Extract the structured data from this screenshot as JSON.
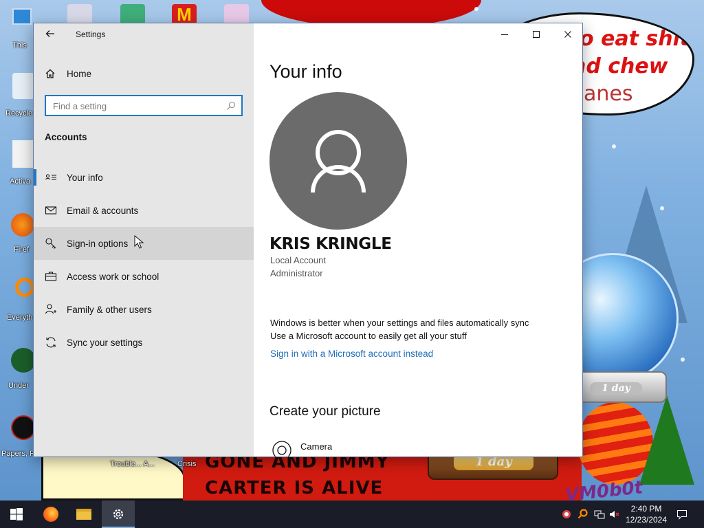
{
  "window": {
    "title": "Settings",
    "minimize_icon": "minimize-icon",
    "maximize_icon": "maximize-icon",
    "close_icon": "close-icon"
  },
  "sidebar": {
    "home_label": "Home",
    "search_placeholder": "Find a setting",
    "section_title": "Accounts",
    "items": [
      {
        "label": "Your info",
        "icon": "your-info-icon",
        "active": true
      },
      {
        "label": "Email & accounts",
        "icon": "mail-icon"
      },
      {
        "label": "Sign-in options",
        "icon": "key-icon",
        "hover": true
      },
      {
        "label": "Access work or school",
        "icon": "briefcase-icon"
      },
      {
        "label": "Family & other users",
        "icon": "person-add-icon"
      },
      {
        "label": "Sync your settings",
        "icon": "sync-icon"
      }
    ]
  },
  "main": {
    "page_title": "Your info",
    "user_name": "KRIS KRINGLE",
    "account_type": "Local Account",
    "role": "Administrator",
    "sync_line1": "Windows is better when your settings and files automatically sync",
    "sync_line2": "Use a Microsoft account to easily get all your stuff",
    "ms_link": "Sign in with a Microsoft account instead",
    "create_picture_heading": "Create your picture",
    "camera_label": "Camera"
  },
  "desktop": {
    "speech_text": [
      "o eat shit",
      "nd chew",
      "anes"
    ],
    "banner_text": [
      "GONE AND JIMMY",
      "CARTER IS ALIVE"
    ],
    "globe_labels": [
      "1 day",
      "1 day"
    ],
    "icons": [
      {
        "label": "This",
        "icon": "computer-icon"
      },
      {
        "label": "Recycle",
        "icon": "recycle-bin-icon"
      },
      {
        "label": "Activa",
        "icon": "app-icon"
      },
      {
        "label": "Firef",
        "icon": "firefox-icon"
      },
      {
        "label": "Everyth",
        "icon": "search-app-icon"
      },
      {
        "label": "Under",
        "icon": "game-icon"
      },
      {
        "label": "Papers, F",
        "icon": "game-icon"
      }
    ],
    "bottom_labels": [
      "Trouble... A...",
      "Crisis"
    ],
    "vm_text": "VM0b0t"
  },
  "taskbar": {
    "time": "2:40 PM",
    "date": "12/23/2024",
    "apps": [
      "start-icon",
      "firefox-icon",
      "file-explorer-icon",
      "settings-icon"
    ]
  },
  "colors": {
    "accent": "#1f78c4",
    "link": "#1f6fb8",
    "sidebar_bg": "#e6e6e6",
    "avatar_bg": "#6b6b6b",
    "taskbar_bg": "#1a1d28"
  }
}
